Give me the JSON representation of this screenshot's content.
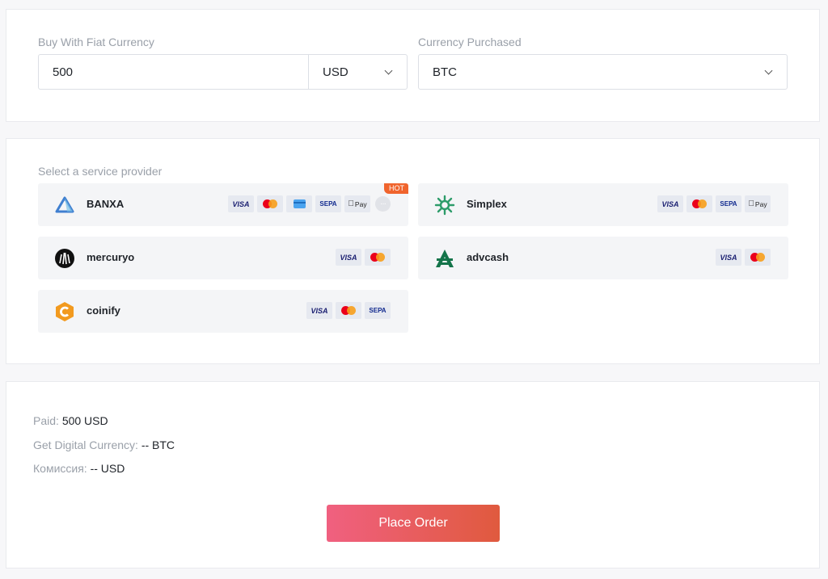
{
  "buy": {
    "fiat_label": "Buy With Fiat Currency",
    "amount_value": "500",
    "fiat_currency": "USD",
    "crypto_label": "Currency Purchased",
    "crypto_currency": "BTC"
  },
  "providers": {
    "section_label": "Select a service provider",
    "hot_badge": "HOT",
    "items": [
      {
        "name": "BANXA",
        "methods": [
          "VISA",
          "Mastercard",
          "Card",
          "SEPA",
          "Apple Pay",
          "More"
        ]
      },
      {
        "name": "Simplex",
        "methods": [
          "VISA",
          "Mastercard",
          "SEPA",
          "Apple Pay"
        ]
      },
      {
        "name": "mercuryo",
        "methods": [
          "VISA",
          "Mastercard"
        ]
      },
      {
        "name": "advcash",
        "methods": [
          "VISA",
          "Mastercard"
        ]
      },
      {
        "name": "coinify",
        "methods": [
          "VISA",
          "Mastercard",
          "SEPA"
        ]
      }
    ],
    "visa_text": "VISA",
    "sepa_text": "SEPA",
    "apay_text": "Pay",
    "more_text": "···"
  },
  "summary": {
    "paid_label": "Paid: ",
    "paid_value": "500 USD",
    "get_label": "Get Digital Currency: ",
    "get_value": "-- BTC",
    "fee_label": "Комиссия: ",
    "fee_value": "-- USD",
    "order_button": "Place Order"
  },
  "colors": {
    "accent_start": "#f06080",
    "accent_end": "#e05a3e",
    "hot_badge": "#f0642d"
  }
}
